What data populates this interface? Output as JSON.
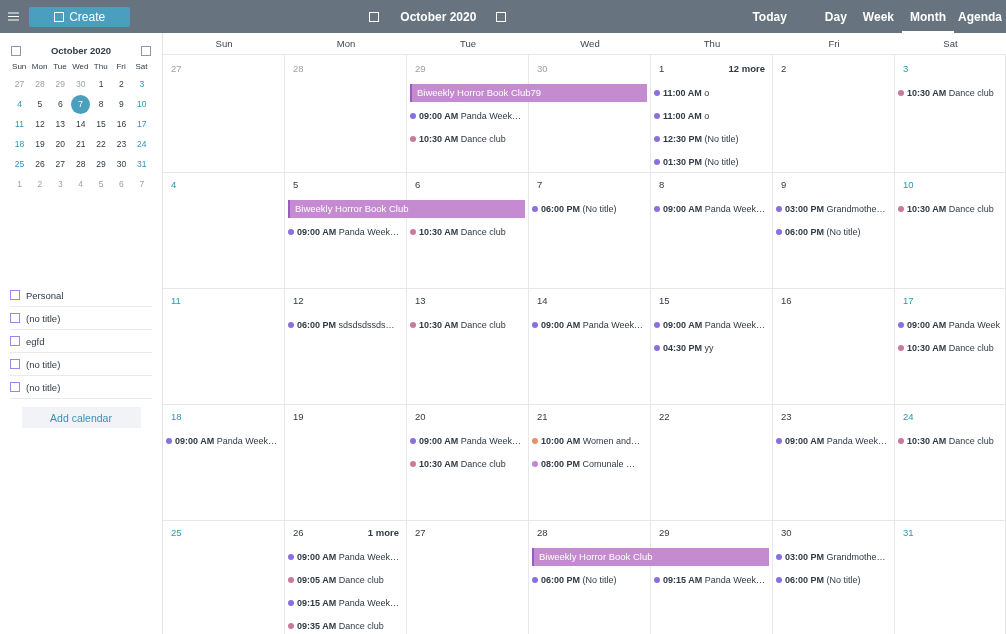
{
  "topbar": {
    "create": "Create",
    "title": "October 2020",
    "today": "Today",
    "views": [
      {
        "label": "Day",
        "selected": false
      },
      {
        "label": "Week",
        "selected": false
      },
      {
        "label": "Month",
        "selected": true
      },
      {
        "label": "Agenda",
        "selected": false
      }
    ]
  },
  "mini_calendar": {
    "title": "October 2020",
    "weekdays": [
      "Sun",
      "Mon",
      "Tue",
      "Wed",
      "Thu",
      "Fri",
      "Sat"
    ],
    "weeks": [
      [
        {
          "label": "27",
          "outside": true,
          "selected": false
        },
        {
          "label": "28",
          "outside": true,
          "selected": false
        },
        {
          "label": "29",
          "outside": true,
          "selected": false
        },
        {
          "label": "30",
          "outside": true,
          "selected": false
        },
        {
          "label": "1",
          "outside": false,
          "selected": false
        },
        {
          "label": "2",
          "outside": false,
          "selected": false
        },
        {
          "label": "3",
          "outside": false,
          "selected": false
        }
      ],
      [
        {
          "label": "4",
          "outside": false,
          "selected": false
        },
        {
          "label": "5",
          "outside": false,
          "selected": false
        },
        {
          "label": "6",
          "outside": false,
          "selected": false
        },
        {
          "label": "7",
          "outside": false,
          "selected": true
        },
        {
          "label": "8",
          "outside": false,
          "selected": false
        },
        {
          "label": "9",
          "outside": false,
          "selected": false
        },
        {
          "label": "10",
          "outside": false,
          "selected": false
        }
      ],
      [
        {
          "label": "11",
          "outside": false,
          "selected": false
        },
        {
          "label": "12",
          "outside": false,
          "selected": false
        },
        {
          "label": "13",
          "outside": false,
          "selected": false
        },
        {
          "label": "14",
          "outside": false,
          "selected": false
        },
        {
          "label": "15",
          "outside": false,
          "selected": false
        },
        {
          "label": "16",
          "outside": false,
          "selected": false
        },
        {
          "label": "17",
          "outside": false,
          "selected": false
        }
      ],
      [
        {
          "label": "18",
          "outside": false,
          "selected": false
        },
        {
          "label": "19",
          "outside": false,
          "selected": false
        },
        {
          "label": "20",
          "outside": false,
          "selected": false
        },
        {
          "label": "21",
          "outside": false,
          "selected": false
        },
        {
          "label": "22",
          "outside": false,
          "selected": false
        },
        {
          "label": "23",
          "outside": false,
          "selected": false
        },
        {
          "label": "24",
          "outside": false,
          "selected": false
        }
      ],
      [
        {
          "label": "25",
          "outside": false,
          "selected": false
        },
        {
          "label": "26",
          "outside": false,
          "selected": false
        },
        {
          "label": "27",
          "outside": false,
          "selected": false
        },
        {
          "label": "28",
          "outside": false,
          "selected": false
        },
        {
          "label": "29",
          "outside": false,
          "selected": false
        },
        {
          "label": "30",
          "outside": false,
          "selected": false
        },
        {
          "label": "31",
          "outside": false,
          "selected": false
        }
      ],
      [
        {
          "label": "1",
          "outside": true,
          "selected": false
        },
        {
          "label": "2",
          "outside": true,
          "selected": false
        },
        {
          "label": "3",
          "outside": true,
          "selected": false
        },
        {
          "label": "4",
          "outside": true,
          "selected": false
        },
        {
          "label": "5",
          "outside": true,
          "selected": false
        },
        {
          "label": "6",
          "outside": true,
          "selected": false
        },
        {
          "label": "7",
          "outside": true,
          "selected": false
        }
      ]
    ]
  },
  "calendars": [
    {
      "name": "Personal",
      "checked": false
    },
    {
      "name": "(no title)",
      "checked": false
    },
    {
      "name": "egfd",
      "checked": false
    },
    {
      "name": "(no title)",
      "checked": false
    },
    {
      "name": "(no title)",
      "checked": false
    }
  ],
  "add_calendar": "Add calendar",
  "month": {
    "weekdays": [
      "Sun",
      "Mon",
      "Tue",
      "Wed",
      "Thu",
      "Fri",
      "Sat"
    ],
    "weeks": [
      {
        "days": [
          {
            "date": "27",
            "outside": true
          },
          {
            "date": "28",
            "outside": true
          },
          {
            "date": "29",
            "outside": true,
            "bar": {
              "title": "Biweekly Horror Book Club79"
            },
            "events": [
              {
                "time": "09:00 AM",
                "title": "Panda Week…",
                "color": "#8a6fe0"
              },
              {
                "time": "10:30 AM",
                "title": "Dance club",
                "color": "#c9799b"
              }
            ]
          },
          {
            "date": "30",
            "outside": true,
            "bar_continues": true
          },
          {
            "date": "1",
            "outside": false,
            "more": "12 more",
            "events": [
              {
                "time": "11:00 AM",
                "title": "o",
                "color": "#8a6fe0"
              },
              {
                "time": "11:00 AM",
                "title": "o",
                "color": "#8a6fe0"
              },
              {
                "time": "12:30 PM",
                "title": "(No title)",
                "color": "#8a6fe0"
              },
              {
                "time": "01:30 PM",
                "title": "(No title)",
                "color": "#8a6fe0"
              }
            ]
          },
          {
            "date": "2",
            "outside": false
          },
          {
            "date": "3",
            "outside": false,
            "events": [
              {
                "time": "10:30 AM",
                "title": "Dance club",
                "color": "#c9799b"
              }
            ]
          }
        ]
      },
      {
        "days": [
          {
            "date": "4",
            "outside": false
          },
          {
            "date": "5",
            "outside": false,
            "bar": {
              "title": "Biweekly Horror Book Club"
            },
            "events": [
              {
                "time": "09:00 AM",
                "title": "Panda Week…",
                "color": "#8a6fe0"
              }
            ]
          },
          {
            "date": "6",
            "outside": false,
            "bar_continues": true,
            "events": [
              {
                "time": "10:30 AM",
                "title": "Dance club",
                "color": "#c9799b"
              }
            ]
          },
          {
            "date": "7",
            "outside": false,
            "events": [
              {
                "time": "06:00 PM",
                "title": "(No title)",
                "color": "#8a6fe0"
              }
            ]
          },
          {
            "date": "8",
            "outside": false,
            "events": [
              {
                "time": "09:00 AM",
                "title": "Panda Week…",
                "color": "#8a6fe0"
              }
            ]
          },
          {
            "date": "9",
            "outside": false,
            "events": [
              {
                "time": "03:00 PM",
                "title": "Grandmothe…",
                "color": "#8a6fe0"
              },
              {
                "time": "06:00 PM",
                "title": "(No title)",
                "color": "#8a6fe0"
              }
            ]
          },
          {
            "date": "10",
            "outside": false,
            "events": [
              {
                "time": "10:30 AM",
                "title": "Dance club",
                "color": "#c9799b"
              }
            ]
          }
        ]
      },
      {
        "days": [
          {
            "date": "11",
            "outside": false
          },
          {
            "date": "12",
            "outside": false,
            "events": [
              {
                "time": "06:00 PM",
                "title": "sdsdsdssds…",
                "color": "#8a6fe0"
              }
            ]
          },
          {
            "date": "13",
            "outside": false,
            "events": [
              {
                "time": "10:30 AM",
                "title": "Dance club",
                "color": "#c9799b"
              }
            ]
          },
          {
            "date": "14",
            "outside": false,
            "events": [
              {
                "time": "09:00 AM",
                "title": "Panda Week…",
                "color": "#8a6fe0"
              }
            ]
          },
          {
            "date": "15",
            "outside": false,
            "events": [
              {
                "time": "09:00 AM",
                "title": "Panda Week…",
                "color": "#8a6fe0"
              },
              {
                "time": "04:30 PM",
                "title": "yy",
                "color": "#8a6fe0"
              }
            ]
          },
          {
            "date": "16",
            "outside": false
          },
          {
            "date": "17",
            "outside": false,
            "events": [
              {
                "time": "09:00 AM",
                "title": "Panda Week",
                "color": "#8a6fe0"
              },
              {
                "time": "10:30 AM",
                "title": "Dance club",
                "color": "#c9799b"
              }
            ]
          }
        ]
      },
      {
        "days": [
          {
            "date": "18",
            "outside": false,
            "events": [
              {
                "time": "09:00 AM",
                "title": "Panda Week…",
                "color": "#8a6fe0"
              }
            ]
          },
          {
            "date": "19",
            "outside": false
          },
          {
            "date": "20",
            "outside": false,
            "events": [
              {
                "time": "09:00 AM",
                "title": "Panda Week…",
                "color": "#8a6fe0"
              },
              {
                "time": "10:30 AM",
                "title": "Dance club",
                "color": "#c9799b"
              }
            ]
          },
          {
            "date": "21",
            "outside": false,
            "events": [
              {
                "time": "10:00 AM",
                "title": "Women and…",
                "color": "#e4926a"
              },
              {
                "time": "08:00 PM",
                "title": "Comunale …",
                "color": "#c185d6"
              }
            ]
          },
          {
            "date": "22",
            "outside": false
          },
          {
            "date": "23",
            "outside": false,
            "events": [
              {
                "time": "09:00 AM",
                "title": "Panda Week…",
                "color": "#8a6fe0"
              }
            ]
          },
          {
            "date": "24",
            "outside": false,
            "events": [
              {
                "time": "10:30 AM",
                "title": "Dance club",
                "color": "#c9799b"
              }
            ]
          }
        ]
      },
      {
        "days": [
          {
            "date": "25",
            "outside": false
          },
          {
            "date": "26",
            "outside": false,
            "more": "1 more",
            "events": [
              {
                "time": "09:00 AM",
                "title": "Panda Week…",
                "color": "#8a6fe0"
              },
              {
                "time": "09:05 AM",
                "title": "Dance club",
                "color": "#c9799b"
              },
              {
                "time": "09:15 AM",
                "title": "Panda Week…",
                "color": "#8a6fe0"
              },
              {
                "time": "09:35 AM",
                "title": "Dance club",
                "color": "#c9799b"
              }
            ]
          },
          {
            "date": "27",
            "outside": false
          },
          {
            "date": "28",
            "outside": false,
            "bar": {
              "title": "Biweekly Horror Book Club"
            },
            "events": [
              {
                "time": "06:00 PM",
                "title": "(No title)",
                "color": "#8a6fe0"
              }
            ]
          },
          {
            "date": "29",
            "outside": false,
            "bar_continues": true,
            "events": [
              {
                "time": "09:15 AM",
                "title": "Panda Week…",
                "color": "#8a6fe0"
              }
            ]
          },
          {
            "date": "30",
            "outside": false,
            "events": [
              {
                "time": "03:00 PM",
                "title": "Grandmothe…",
                "color": "#8a6fe0"
              },
              {
                "time": "06:00 PM",
                "title": "(No title)",
                "color": "#8a6fe0"
              }
            ]
          },
          {
            "date": "31",
            "outside": false
          }
        ]
      }
    ]
  }
}
